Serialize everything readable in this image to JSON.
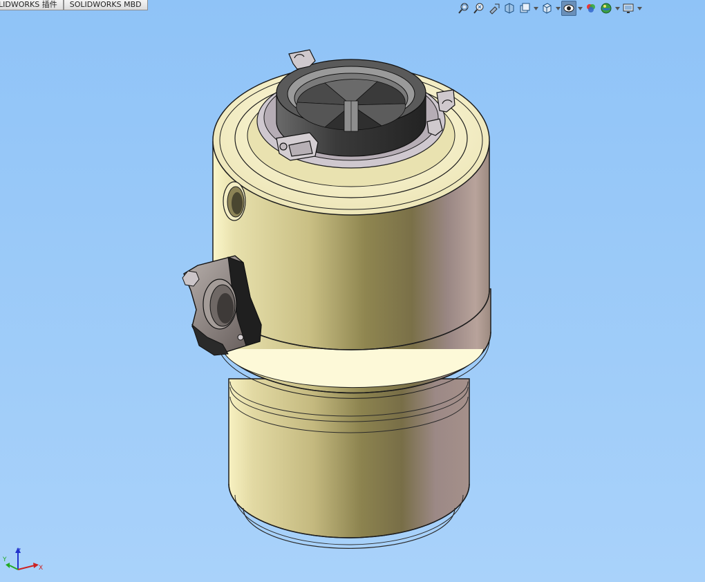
{
  "tabs": [
    {
      "label": "LIDWORKS 插件"
    },
    {
      "label": "SOLIDWORKS MBD"
    }
  ],
  "toolbar": {
    "buttons": [
      {
        "icon": "zoom-to-fit-icon"
      },
      {
        "icon": "zoom-to-area-icon"
      },
      {
        "icon": "previous-view-icon"
      },
      {
        "icon": "section-view-icon"
      },
      {
        "icon": "dynamic-annotation-icon"
      },
      {
        "icon": "view-orientation-icon"
      },
      {
        "icon": "display-style-icon"
      },
      {
        "icon": "hide-show-items-icon"
      },
      {
        "icon": "edit-appearance-icon"
      },
      {
        "icon": "apply-scene-icon"
      },
      {
        "icon": "view-settings-icon"
      }
    ]
  },
  "triad": {
    "x": "X",
    "y": "Y",
    "z": "Z"
  },
  "colors": {
    "background_top": "#8fc3f7",
    "background_bottom": "#a9d2fa",
    "body": "#e8e2b4",
    "body_shadow": "#9c8a80",
    "dark_plastic": "#3c3c3c",
    "flange": "#8c8484"
  }
}
